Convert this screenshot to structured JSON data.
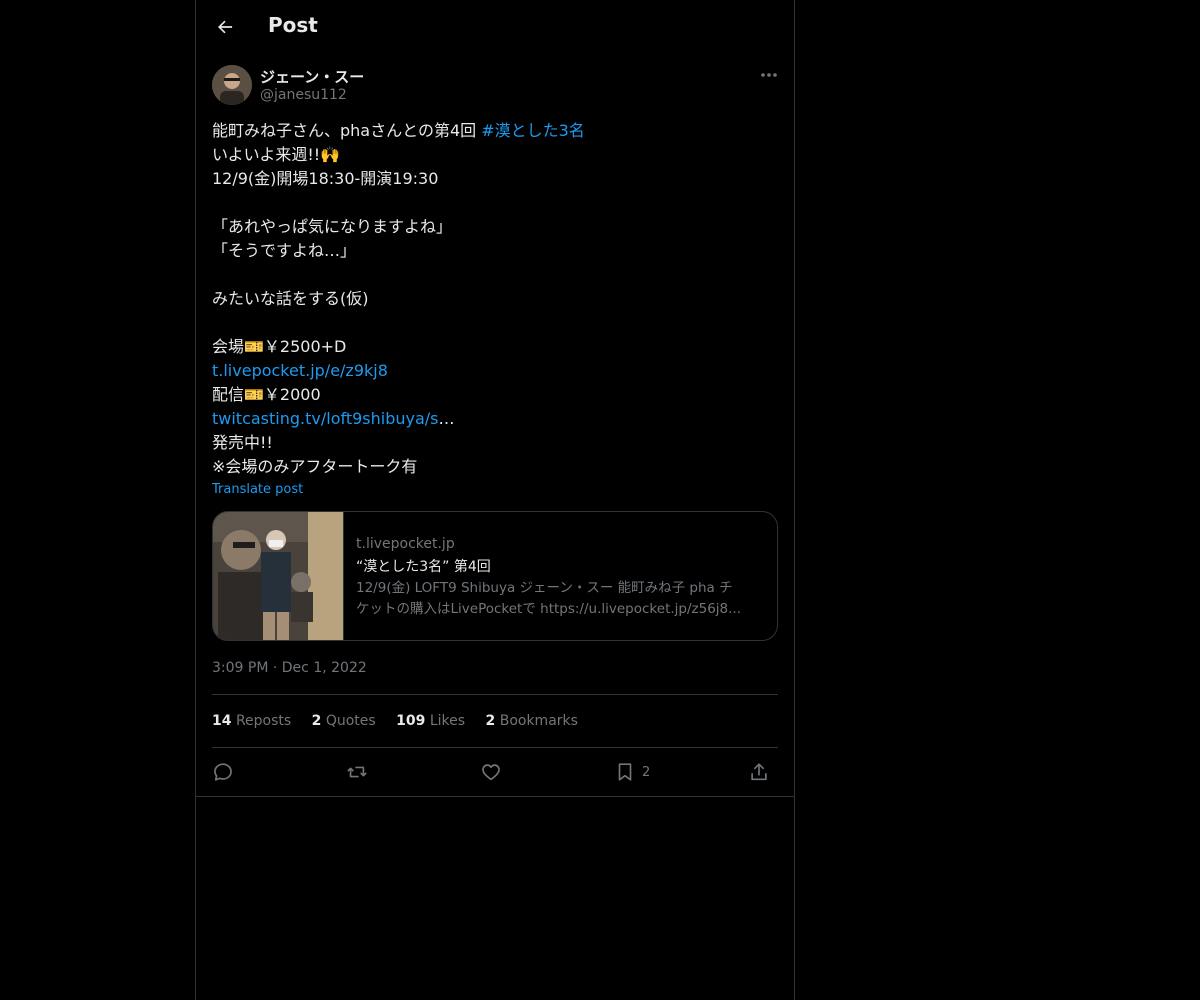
{
  "header": {
    "title": "Post"
  },
  "author": {
    "display_name": "ジェーン・スー",
    "handle": "@janesu112"
  },
  "tweet": {
    "line1_text": "能町みね子さん、phaさんとの第4回 ",
    "line1_hashtag": "#漠とした3名",
    "line2": "いよいよ来週!!🙌",
    "line3": "12/9(金)開場18:30-開演19:30",
    "line5": "「あれやっぱ気になりますよね」",
    "line6": "「そうですよね…」",
    "line8": "みたいな話をする(仮)",
    "line10": "会場🎫￥2500+D",
    "link1": "t.livepocket.jp/e/z9kj8",
    "line12": "配信🎫￥2000",
    "link2": "twitcasting.tv/loft9shibuya/s",
    "link2_ellipsis": "…",
    "line14": "発売中!!",
    "line15": "※会場のみアフタートーク有"
  },
  "translate_label": "Translate post",
  "card": {
    "domain": "t.livepocket.jp",
    "title": "“漠とした3名” 第4回",
    "description_line1": "12/9(金) LOFT9 Shibuya ジェーン・スー 能町みね子 pha チ",
    "description_line2": "ケットの購入はLivePocketで https://u.livepocket.jp/z56j8..."
  },
  "timestamp": {
    "time": "3:09 PM",
    "separator": "·",
    "date": "Dec 1, 2022"
  },
  "stats": [
    {
      "count": "14",
      "label": "Reposts"
    },
    {
      "count": "2",
      "label": "Quotes"
    },
    {
      "count": "109",
      "label": "Likes"
    },
    {
      "count": "2",
      "label": "Bookmarks"
    }
  ],
  "actions": {
    "reply": {
      "icon": "reply-icon",
      "count": ""
    },
    "repost": {
      "icon": "repost-icon",
      "count": ""
    },
    "like": {
      "icon": "heart-icon",
      "count": ""
    },
    "bookmark": {
      "icon": "bookmark-icon",
      "count": "2"
    },
    "share": {
      "icon": "share-icon",
      "count": ""
    }
  },
  "colors": {
    "background": "#000000",
    "text": "#e7e9ea",
    "muted": "#71767b",
    "link": "#1d9bf0",
    "border": "#2f3336"
  }
}
